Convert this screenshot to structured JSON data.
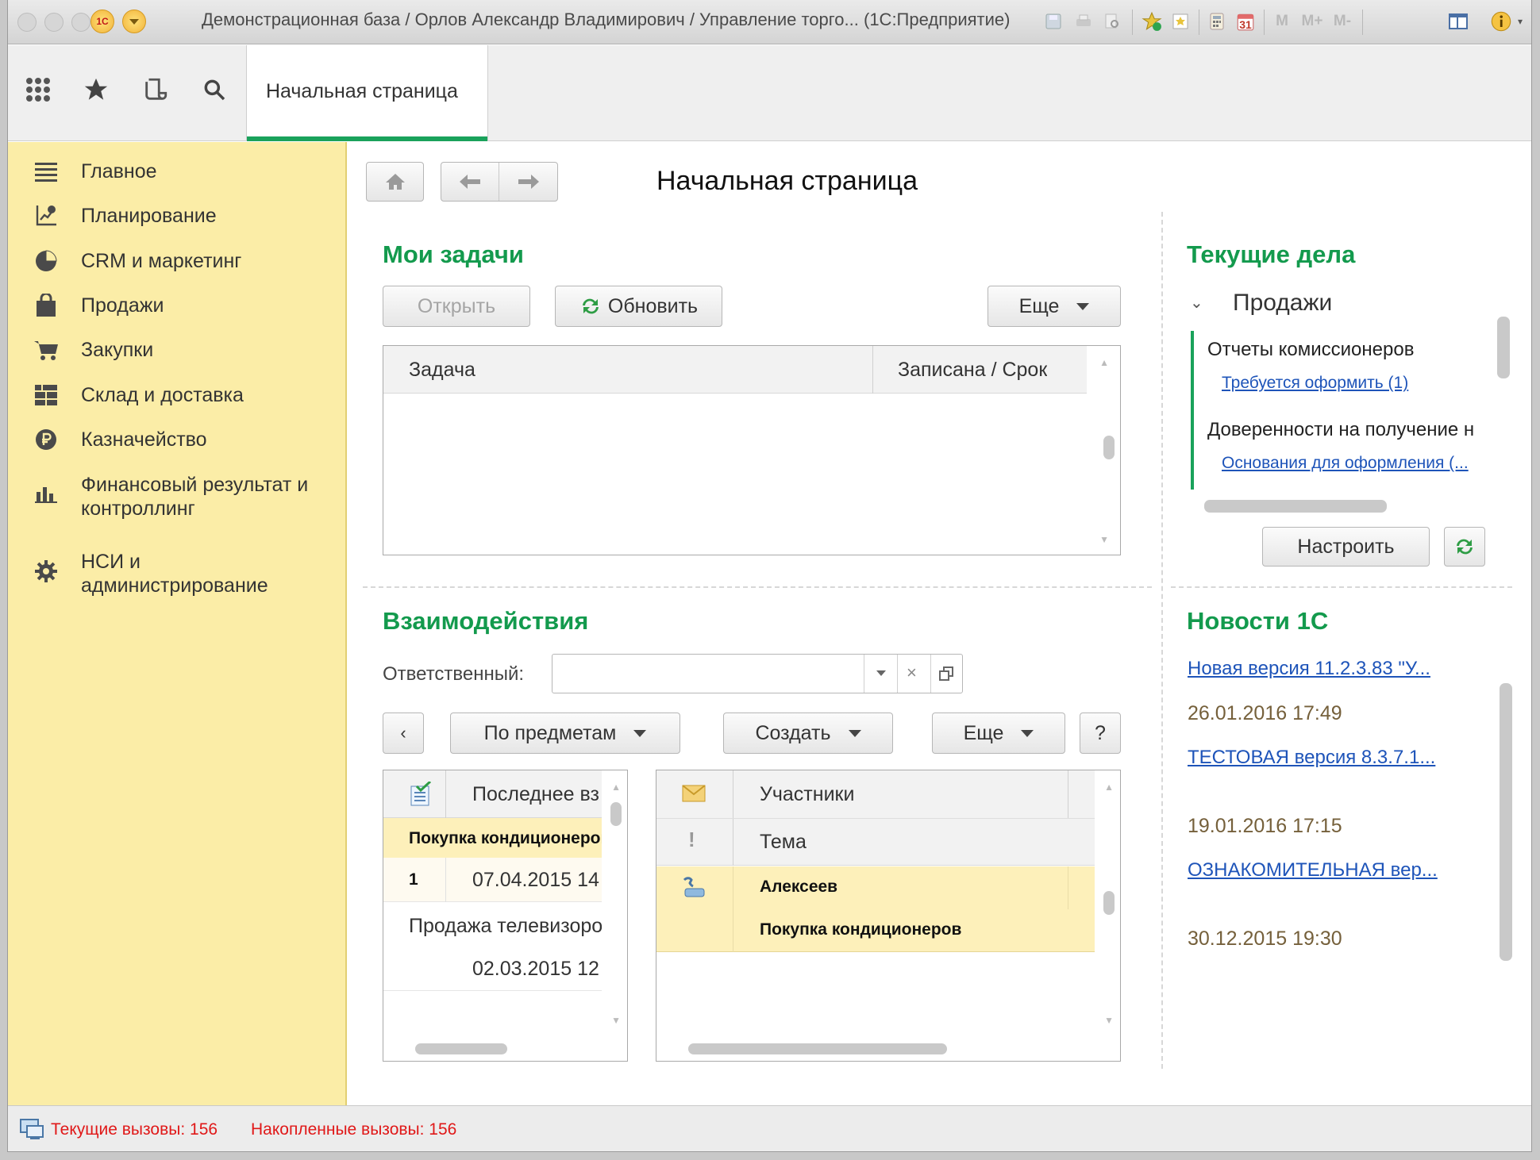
{
  "window": {
    "title": "Демонстрационная база / Орлов Александр Владимирович / Управление торго...  (1С:Предприятие)",
    "title_toolbar_icons": [
      "save-icon",
      "print-icon",
      "print-preview-icon",
      "add-favorite-icon",
      "favorites-icon",
      "calculator-icon",
      "calendar-icon",
      "m-icon",
      "m-plus-icon",
      "m-minus-icon",
      "panels-icon",
      "info-icon"
    ],
    "calendar_day": "31",
    "memory_buttons": [
      "M",
      "M+",
      "M-"
    ]
  },
  "toolbar": {
    "icons": [
      "apps-grid-icon",
      "star-icon",
      "history-icon",
      "search-icon"
    ],
    "tab_label": "Начальная страница"
  },
  "sidebar": {
    "items": [
      {
        "label": "Главное",
        "icon": "menu-lines-icon"
      },
      {
        "label": "Планирование",
        "icon": "planning-icon"
      },
      {
        "label": "CRM и маркетинг",
        "icon": "pie-chart-icon"
      },
      {
        "label": "Продажи",
        "icon": "bag-icon"
      },
      {
        "label": "Закупки",
        "icon": "cart-icon"
      },
      {
        "label": "Склад и доставка",
        "icon": "warehouse-grid-icon"
      },
      {
        "label": "Казначейство",
        "icon": "ruble-icon"
      },
      {
        "label": "Финансовый результат и контроллинг",
        "line1": "Финансовый результат и",
        "line2": "контроллинг",
        "icon": "bar-chart-icon"
      },
      {
        "label": "НСИ и администрирование",
        "line1": "НСИ и",
        "line2": "администрирование",
        "icon": "gear-icon"
      }
    ]
  },
  "page": {
    "title": "Начальная страница"
  },
  "tasks": {
    "heading": "Мои задачи",
    "open_label": "Открыть",
    "refresh_label": "Обновить",
    "more_label": "Еще",
    "columns": [
      "Задача",
      "Записана / Срок"
    ]
  },
  "current": {
    "heading": "Текущие дела",
    "group": "Продажи",
    "items": [
      {
        "title": "Отчеты комиссионеров",
        "link": "Требуется оформить (1)"
      },
      {
        "title": "Доверенности на получение н",
        "link": "Основания для оформления (..."
      }
    ],
    "setup_label": "Настроить"
  },
  "interactions": {
    "heading": "Взаимодействия",
    "responsible_label": "Ответственный:",
    "responsible_value": "",
    "by_subject_label": "По предметам",
    "create_label": "Создать",
    "more_label": "Еще",
    "help_label": "?",
    "left_grid": {
      "column": "Последнее вз",
      "rows": [
        {
          "title": "Покупка кондиционеров",
          "count": "1",
          "date": "07.04.2015 14"
        },
        {
          "title": "Продажа телевизоров",
          "date": "02.03.2015 12"
        }
      ]
    },
    "right_grid": {
      "col_participants": "Участники",
      "col_subject": "Тема",
      "row_participant": "Алексеев",
      "row_subject": "Покупка кондиционеров"
    }
  },
  "news": {
    "heading": "Новости 1С",
    "items": [
      {
        "link": "Новая версия 11.2.3.83 \"У...",
        "date": "26.01.2016 17:49"
      },
      {
        "link": "ТЕСТОВАЯ версия 8.3.7.1...",
        "date": "19.01.2016 17:15"
      },
      {
        "link": "ОЗНАКОМИТЕЛЬНАЯ вер...",
        "date": "30.12.2015 19:30"
      }
    ]
  },
  "status": {
    "current_calls": "Текущие вызовы: 156",
    "accumulated_calls": "Накопленные вызовы: 156"
  },
  "colors": {
    "accent_green": "#139a4d",
    "sidebar_bg": "#fbeda7",
    "link_blue": "#1e54b9",
    "status_red": "#e01818"
  }
}
